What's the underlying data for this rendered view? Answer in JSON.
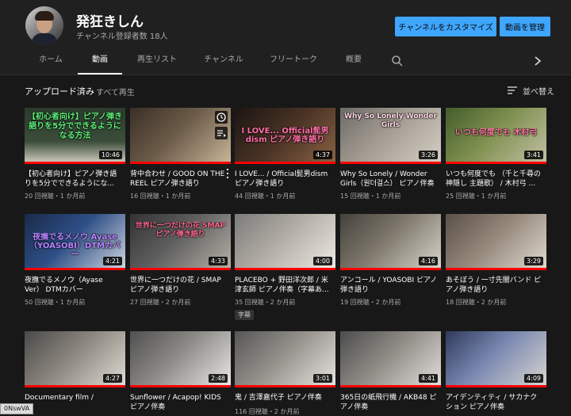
{
  "channel": {
    "name": "発狂きしん",
    "subscribers": "チャンネル登録者数 18人",
    "customize_label": "チャンネルをカスタマイズ",
    "manage_label": "動画を管理"
  },
  "tabs": [
    "ホーム",
    "動画",
    "再生リスト",
    "チャンネル",
    "フリートーク",
    "概要"
  ],
  "filter": {
    "title": "アップロード済み",
    "play_all": "すべて再生",
    "sort_label": "並べ替え"
  },
  "colors": {
    "accent": "#3ea6ff",
    "progress": "#ff0000",
    "background": "#181818",
    "header": "#202020"
  },
  "icons": {
    "search": "search-icon",
    "next": "chevron-right-icon",
    "sort": "sort-icon",
    "watch_later": "clock-icon",
    "queue": "add-to-queue-icon",
    "more": "more-vertical-icon"
  },
  "videos": [
    {
      "title": "【初心者向け】ピアノ弾き語りを5分でできるようにな...",
      "meta": "20 回視聴・1 か月前",
      "duration": "10:46",
      "thumb_text": "【初心者向け】ピアノ弾き語りを5分でできるようになる方法"
    },
    {
      "title": "背中合わせ / GOOD ON THE REEL ピアノ弾き語り",
      "meta": "16 回視聴・1 か月前",
      "duration": "",
      "thumb_text": ""
    },
    {
      "title": "I LOVE... / Official髭男dism ピアノ弾き語り",
      "meta": "44 回視聴・1 か月前",
      "duration": "4:37",
      "thumb_text": "I LOVE... Official髭男dism ピアノ弾き語り"
    },
    {
      "title": "Why So Lonely / Wonder Girls（원더걸스） ピアノ伴奏",
      "meta": "15 回視聴・1 か月前",
      "duration": "3:26",
      "thumb_text": "Why So Lonely Wonder Girls"
    },
    {
      "title": "いつも何度でも （千と千尋の神隠し 主題歌） / 木村弓 ...",
      "meta": "25 回視聴・1 か月前",
      "duration": "3:41",
      "thumb_text": "いつも何度でも 木村弓"
    },
    {
      "title": "夜撫でるメノウ（Ayase Ver） DTMカバー",
      "meta": "50 回視聴・1 か月前",
      "duration": "4:21",
      "thumb_text": "夜撫でるメノウ Ayase（YOASOBI）DTMカバー"
    },
    {
      "title": "世界に一つだけの花 / SMAP ピアノ弾き語り",
      "meta": "27 回視聴・2 か月前",
      "duration": "4:33",
      "thumb_text": "世界に一つだけの花 SMAP ピアノ弾き語り"
    },
    {
      "title": "PLACEBO + 野田洋次郎 / 米津玄師 ピアノ伴奏（字幕あ...",
      "meta": "35 回視聴・2 か月前",
      "duration": "4:00",
      "thumb_text": "",
      "badge": "字幕"
    },
    {
      "title": "アンコール / YOASOBI ピアノ弾き語り",
      "meta": "19 回視聴・2 か月前",
      "duration": "4:16",
      "thumb_text": ""
    },
    {
      "title": "あそぼう / 一寸先闇バンド ピアノ弾き語り",
      "meta": "18 回視聴・2 か月前",
      "duration": "3:29",
      "thumb_text": ""
    },
    {
      "title": "Documentary film /",
      "meta": "",
      "duration": "4:27",
      "thumb_text": ""
    },
    {
      "title": "Sunflower / Acapop! KIDS ピアノ伴奏",
      "meta": "",
      "duration": "2:48",
      "thumb_text": ""
    },
    {
      "title": "鬼 / 吉澤嘉代子 ピアノ伴奏",
      "meta": "116 回視聴・2 か月前",
      "duration": "3:01",
      "thumb_text": ""
    },
    {
      "title": "365日の紙飛行機 / AKB48 ピアノ伴奏",
      "meta": "",
      "duration": "4:41",
      "thumb_text": ""
    },
    {
      "title": "アイデンティティ / サカナクション ピアノ伴奏",
      "meta": "",
      "duration": "4:09",
      "thumb_text": ""
    }
  ],
  "url_tooltip": "0NswVA"
}
